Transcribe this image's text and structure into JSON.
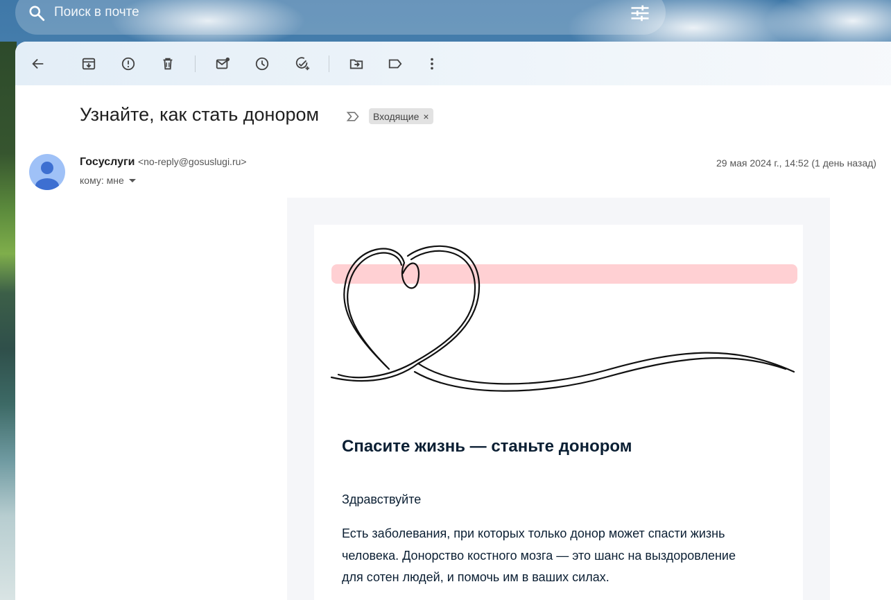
{
  "search": {
    "placeholder": "Поиск в почте"
  },
  "toolbar": {
    "icons": [
      "back-arrow-icon",
      "archive-icon",
      "report-spam-icon",
      "delete-icon",
      "mark-unread-icon",
      "snooze-icon",
      "add-task-icon",
      "move-to-icon",
      "label-icon",
      "more-options-icon"
    ]
  },
  "message": {
    "subject": "Узнайте, как стать донором",
    "label": "Входящие",
    "label_remove": "×",
    "sender_name": "Госуслуги",
    "sender_email": "<no-reply@gosuslugi.ru>",
    "to": "кому: мне",
    "date": "29 мая 2024 г., 14:52 (1 день назад)"
  },
  "email_body": {
    "heading": "Спасите жизнь — станьте донором",
    "greeting": "Здравствуйте",
    "paragraph": "Есть заболевания, при которых только донор может спасти жизнь человека. Донорство костного мозга — это шанс на выздоровление для сотен людей, и помочь им в ваших силах."
  },
  "colors": {
    "heading_text": "#0b1f33",
    "email_background": "#f5f6f9",
    "banner_stripe": "#ffd0d3",
    "avatar": "#9fc1f7"
  }
}
